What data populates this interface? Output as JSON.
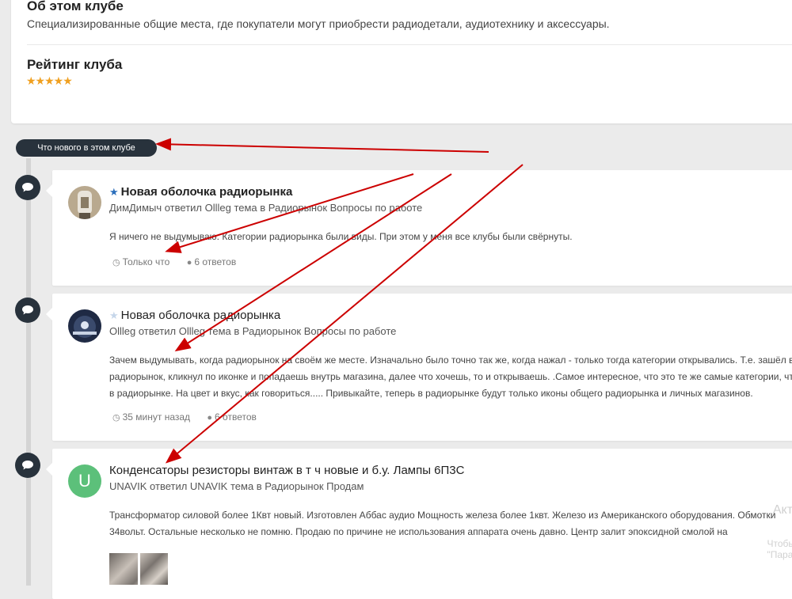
{
  "about": {
    "title": "Об этом клубе",
    "description": "Специализированные общие места, где покупатели могут приобрести радиодетали, аудиотехнику и аксессуары."
  },
  "rating": {
    "title": "Рейтинг клуба",
    "stars": "★★★★★",
    "value": 5
  },
  "whats_new_label": "Что нового в этом клубе",
  "posts": [
    {
      "title": "Новая оболочка радиорынка",
      "featured": true,
      "star_color": "#2a6ebb",
      "meta": "ДимДимыч ответил Ollleg тема в Радиорынок Вопросы по работе",
      "body": [
        "Я ничего не выдумываю. Категории радиорынка были виды. При этом у меня все клубы были свёрнуты."
      ],
      "time": "Только что",
      "replies": "6 ответов"
    },
    {
      "title": "Новая оболочка радиорынка",
      "featured": false,
      "star_color": "#c6d6ea",
      "meta": "Ollleg ответил Ollleg тема в Радиорынок Вопросы по работе",
      "body": [
        "Зачем выдумывать, когда радиорынок на своём же месте. Изначально было точно так же, когда нажал - только тогда категории открывались. Т.е. зашёл в",
        "радиорынок, кликнул по иконке и попадаешь внутрь магазина, далее что хочешь, то и открываешь. .Самое интересное, что это те же самые категории, что",
        "в радиорынке. На цвет и вкус, как говориться..... Привыкайте, теперь в радиорынке будут только иконы общего радиорынка и личных магазинов."
      ],
      "time": "35 минут назад",
      "replies": "6 ответов"
    },
    {
      "title": "Конденсаторы резисторы винтаж в т ч новые и б.у. Лампы 6П3С",
      "avatar_letter": "U",
      "meta": "UNAVIK ответил UNAVIK тема в Радиорынок Продам",
      "body": [
        "Трансформатор силовой более 1Квт новый. Изготовлен Аббас аудио Мощность железа более 1квт. Железо из Американского оборудования. Обмотки",
        "34вольт. Остальные несколько не помню. Продаю по причине не использования аппарата очень давно. Центр залит эпоксидной смолой на"
      ]
    }
  ],
  "watermark": {
    "line1": "Акти",
    "line2": "Чтобы",
    "line3": "\"Пара"
  },
  "colors": {
    "accent_dark": "#28323c",
    "star": "#f0a020",
    "arrow": "#cc0000",
    "avatar_u": "#5cc07a"
  }
}
